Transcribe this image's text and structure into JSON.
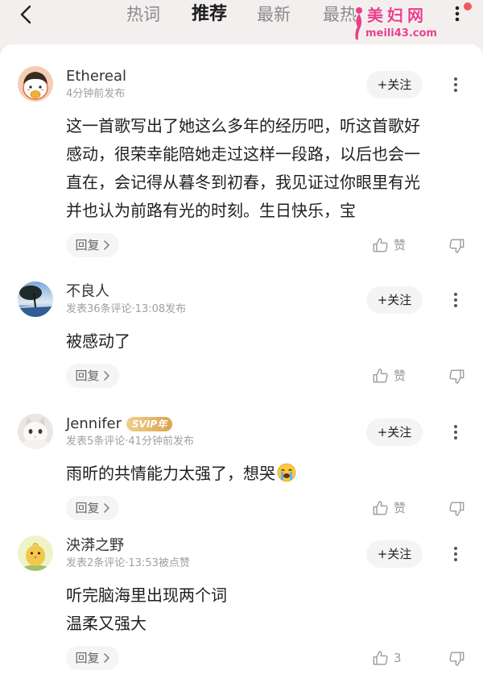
{
  "header": {
    "back_icon": "chevron-left-icon",
    "tabs": [
      "热词",
      "推荐",
      "最新",
      "最热"
    ],
    "active_tab_index": 1,
    "more_icon": "more-vertical-icon",
    "has_notification_dot": true,
    "watermark": {
      "name": "美妇网",
      "site": "meili43.com"
    }
  },
  "comments": [
    {
      "avatar_icon": "cartoon-girl-avatar",
      "name": "Ethereal",
      "meta": "4分钟前发布",
      "follow_label": "+关注",
      "lines": [
        "这一首歌写出了她这么多年的经历吧，听这首歌好",
        "感动，很荣幸能陪她走过这样一段路，以后也会一",
        "直在，会记得从暮冬到初春，我见证过你眼里有光",
        "并也认为前路有光的时刻。生日快乐，宝"
      ],
      "reply_label": "回复",
      "like_label": "赞"
    },
    {
      "avatar_icon": "lakeside-tree-avatar",
      "name": "不良人",
      "meta": "发表36条评论·13:08发布",
      "follow_label": "+关注",
      "lines": [
        "被感动了"
      ],
      "reply_label": "回复",
      "like_label": "赞"
    },
    {
      "avatar_icon": "white-cat-avatar",
      "name": "Jennifer",
      "badge": "SVIP年",
      "meta": "发表5条评论·41分钟前发布",
      "follow_label": "+关注",
      "lines": [
        "雨昕的共情能力太强了，想哭"
      ],
      "trailing_emoji_icon": "loudly-crying-face-emoji",
      "reply_label": "回复",
      "like_label": "赞"
    },
    {
      "avatar_icon": "yellow-chick-avatar",
      "name": "泱漭之野",
      "meta": "发表2条评论·13:53被点赞",
      "follow_label": "+关注",
      "lines": [
        "听完脑海里出现两个词",
        "温柔又强大"
      ],
      "reply_label": "回复",
      "like_count": "3"
    }
  ],
  "colors": {
    "page_background": "#f3efef",
    "card_background": "#ffffff",
    "active_tab": "#1c1c1c",
    "inactive_tab": "#8a8a8a",
    "body_text": "#1f1f1f",
    "meta_text": "#a0a0a0",
    "notification_dot": "#f05a5a",
    "watermark": "#e8408a",
    "vip_badge": "#e2b25c"
  }
}
